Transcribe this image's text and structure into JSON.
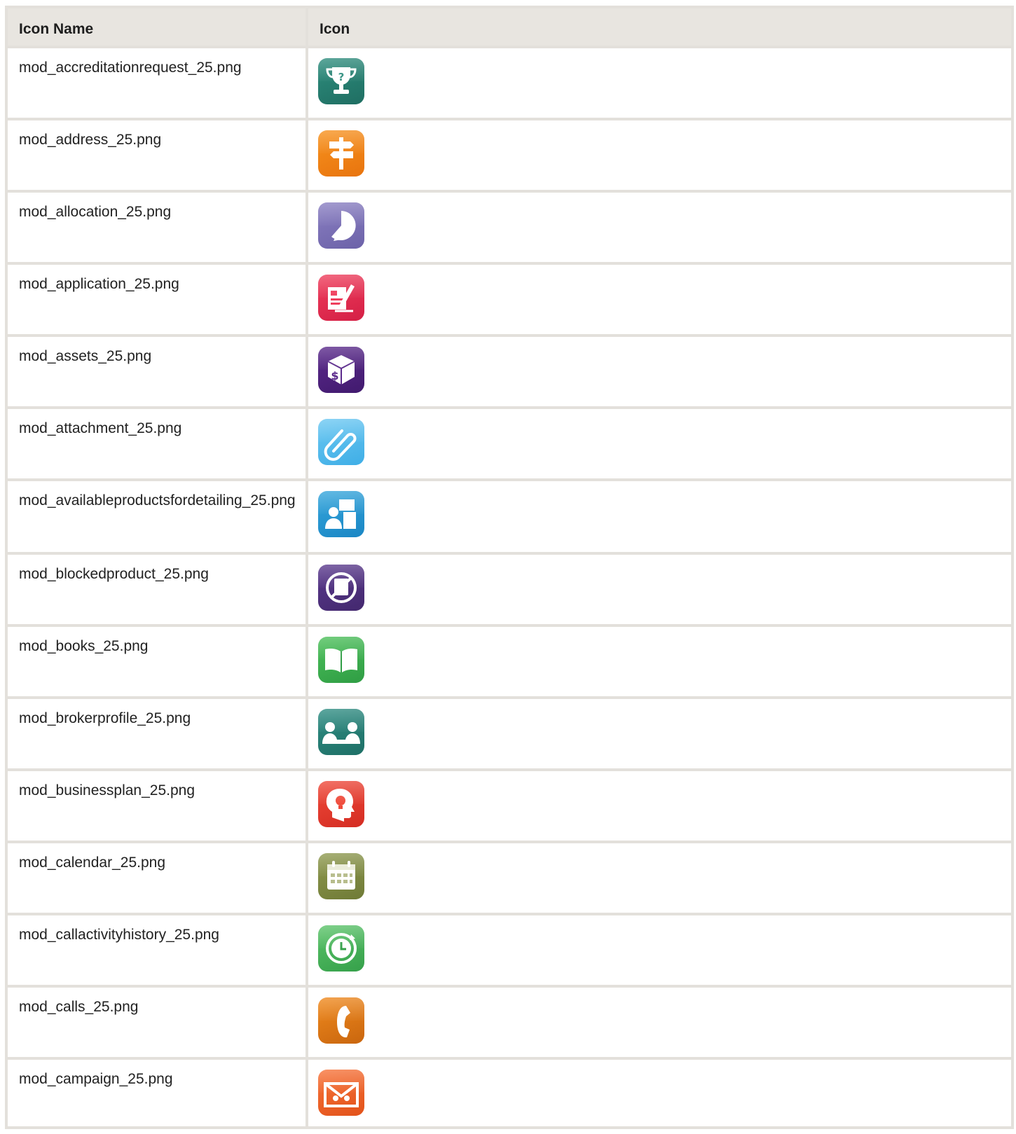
{
  "table": {
    "headers": {
      "name": "Icon Name",
      "icon": "Icon"
    },
    "rows": [
      {
        "name": "mod_accreditationrequest_25.png",
        "icon": "trophy-question-icon",
        "color": "#2e8e7e",
        "color2": "#1f6e62"
      },
      {
        "name": "mod_address_25.png",
        "icon": "signpost-icon",
        "color": "#f7921e",
        "color2": "#e8740e"
      },
      {
        "name": "mod_allocation_25.png",
        "icon": "pie-slice-icon",
        "color": "#8a7fc2",
        "color2": "#6c62a8"
      },
      {
        "name": "mod_application_25.png",
        "icon": "form-pencil-icon",
        "color": "#ef3e5c",
        "color2": "#d41f45"
      },
      {
        "name": "mod_assets_25.png",
        "icon": "dollar-box-icon",
        "color": "#5b2a8c",
        "color2": "#411a6e"
      },
      {
        "name": "mod_attachment_25.png",
        "icon": "paperclip-icon",
        "color": "#6cc8f2",
        "color2": "#3faee6"
      },
      {
        "name": "mod_availableproductsfordetailing_25.png",
        "icon": "person-products-icon",
        "color": "#35a6dc",
        "color2": "#1a86c4"
      },
      {
        "name": "mod_blockedproduct_25.png",
        "icon": "blocked-product-icon",
        "color": "#5b3a8e",
        "color2": "#43286e"
      },
      {
        "name": "mod_books_25.png",
        "icon": "open-book-icon",
        "color": "#4cc05a",
        "color2": "#2f9d44"
      },
      {
        "name": "mod_brokerprofile_25.png",
        "icon": "handshake-people-icon",
        "color": "#2f8e84",
        "color2": "#1e6f66"
      },
      {
        "name": "mod_businessplan_25.png",
        "icon": "head-lightbulb-icon",
        "color": "#ef4a3a",
        "color2": "#d42c22"
      },
      {
        "name": "mod_calendar_25.png",
        "icon": "calendar-icon",
        "color": "#8f9a50",
        "color2": "#6f7a36"
      },
      {
        "name": "mod_callactivityhistory_25.png",
        "icon": "clock-history-icon",
        "color": "#5cc46a",
        "color2": "#35a04a"
      },
      {
        "name": "mod_calls_25.png",
        "icon": "phone-icon",
        "color": "#f08a1e",
        "color2": "#c9660e"
      },
      {
        "name": "mod_campaign_25.png",
        "icon": "envelope-people-icon",
        "color": "#f7743a",
        "color2": "#e2521a"
      }
    ]
  }
}
